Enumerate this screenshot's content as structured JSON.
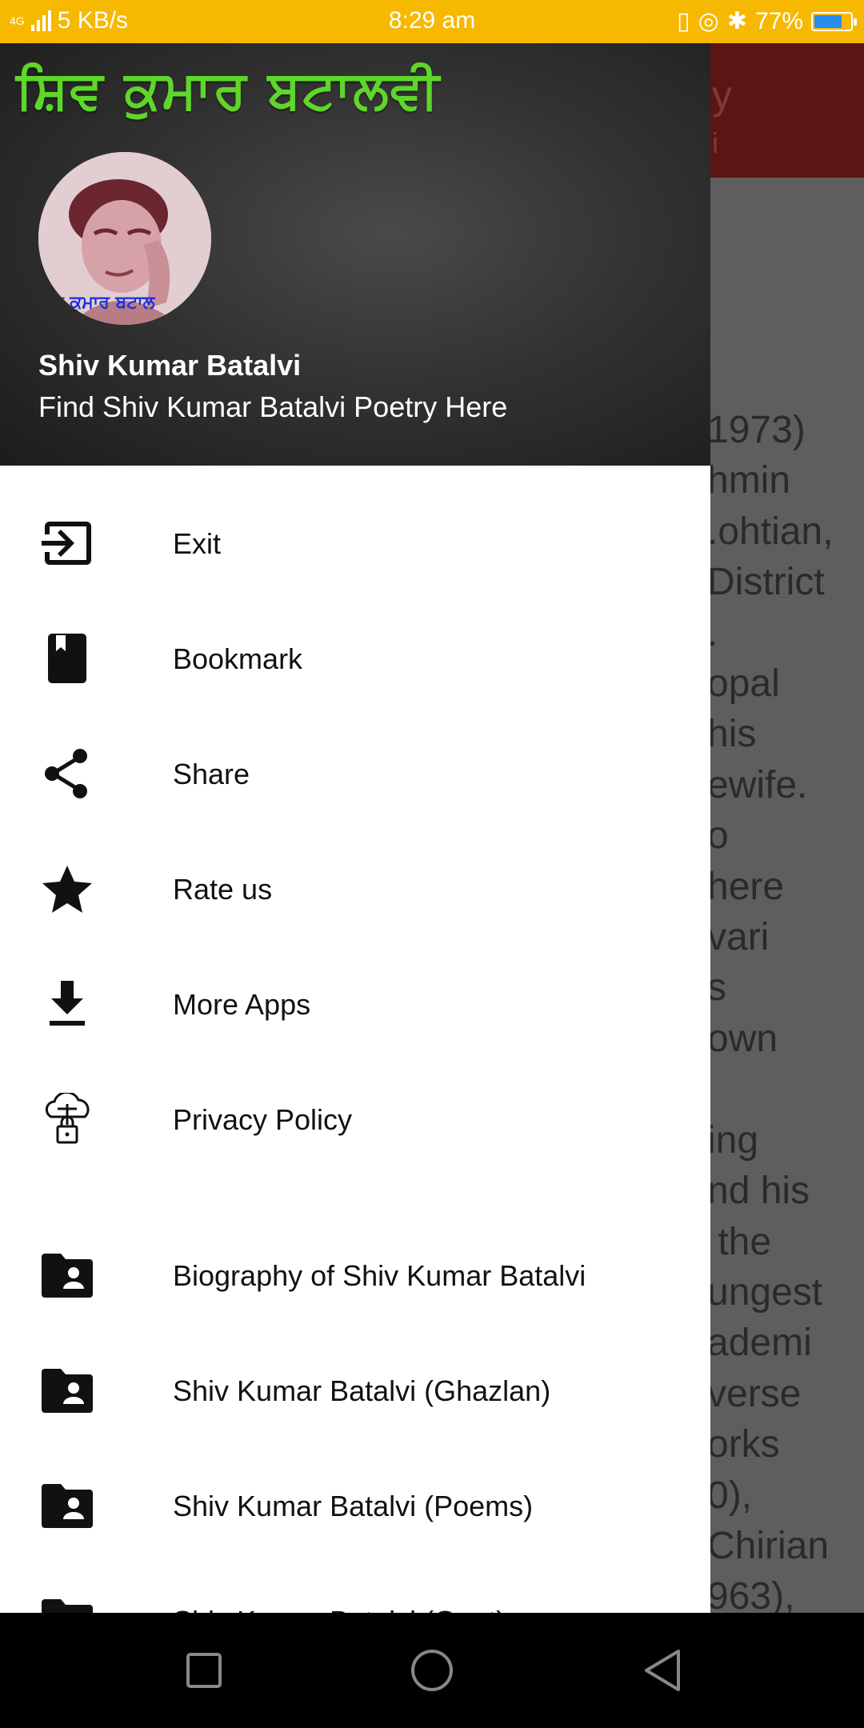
{
  "status_bar": {
    "network": "4G",
    "speed": "5 KB/s",
    "time": "8:29 am",
    "battery": "77%",
    "battery_level": 0.77
  },
  "background_page": {
    "title_fragment": "y",
    "subtitle_fragment": "i",
    "text_lines": [
      "1973)",
      "hmin",
      ".ohtian,",
      "District",
      ".",
      "opal",
      "his",
      "ewife.",
      "o",
      "here",
      "vari",
      "s",
      "own",
      "",
      "ing",
      "nd his",
      " the",
      "ungest",
      "ademi",
      "verse",
      "orks",
      "0),",
      "Chirian",
      "963),"
    ]
  },
  "drawer": {
    "header": {
      "banner_text": "ਸ਼ਿਵ ਕੁਮਾਰ ਬਟਾਲਵੀ",
      "avatar_caption": "ਵ ਕੁਮਾਰ ਬਟਾਲ",
      "name": "Shiv Kumar Batalvi",
      "subtitle": "Find Shiv Kumar Batalvi Poetry Here"
    },
    "items": [
      {
        "label": "Exit",
        "icon": "exit-icon"
      },
      {
        "label": "Bookmark",
        "icon": "bookmark-icon"
      },
      {
        "label": "Share",
        "icon": "share-icon"
      },
      {
        "label": "Rate us",
        "icon": "star-icon"
      },
      {
        "label": "More Apps",
        "icon": "download-icon"
      },
      {
        "label": "Privacy Policy",
        "icon": "cloud-lock-icon"
      },
      {
        "label": "Biography of Shiv Kumar Batalvi",
        "icon": "folder-user-icon"
      },
      {
        "label": "Shiv Kumar Batalvi (Ghazlan)",
        "icon": "folder-user-icon"
      },
      {
        "label": "Shiv Kumar Batalvi (Poems)",
        "icon": "folder-user-icon"
      },
      {
        "label": "Shiv Kumar Batalvi (Geet)",
        "icon": "folder-user-icon"
      }
    ]
  },
  "nav_bar": {
    "buttons": [
      "recents-icon",
      "home-icon",
      "back-icon"
    ]
  }
}
